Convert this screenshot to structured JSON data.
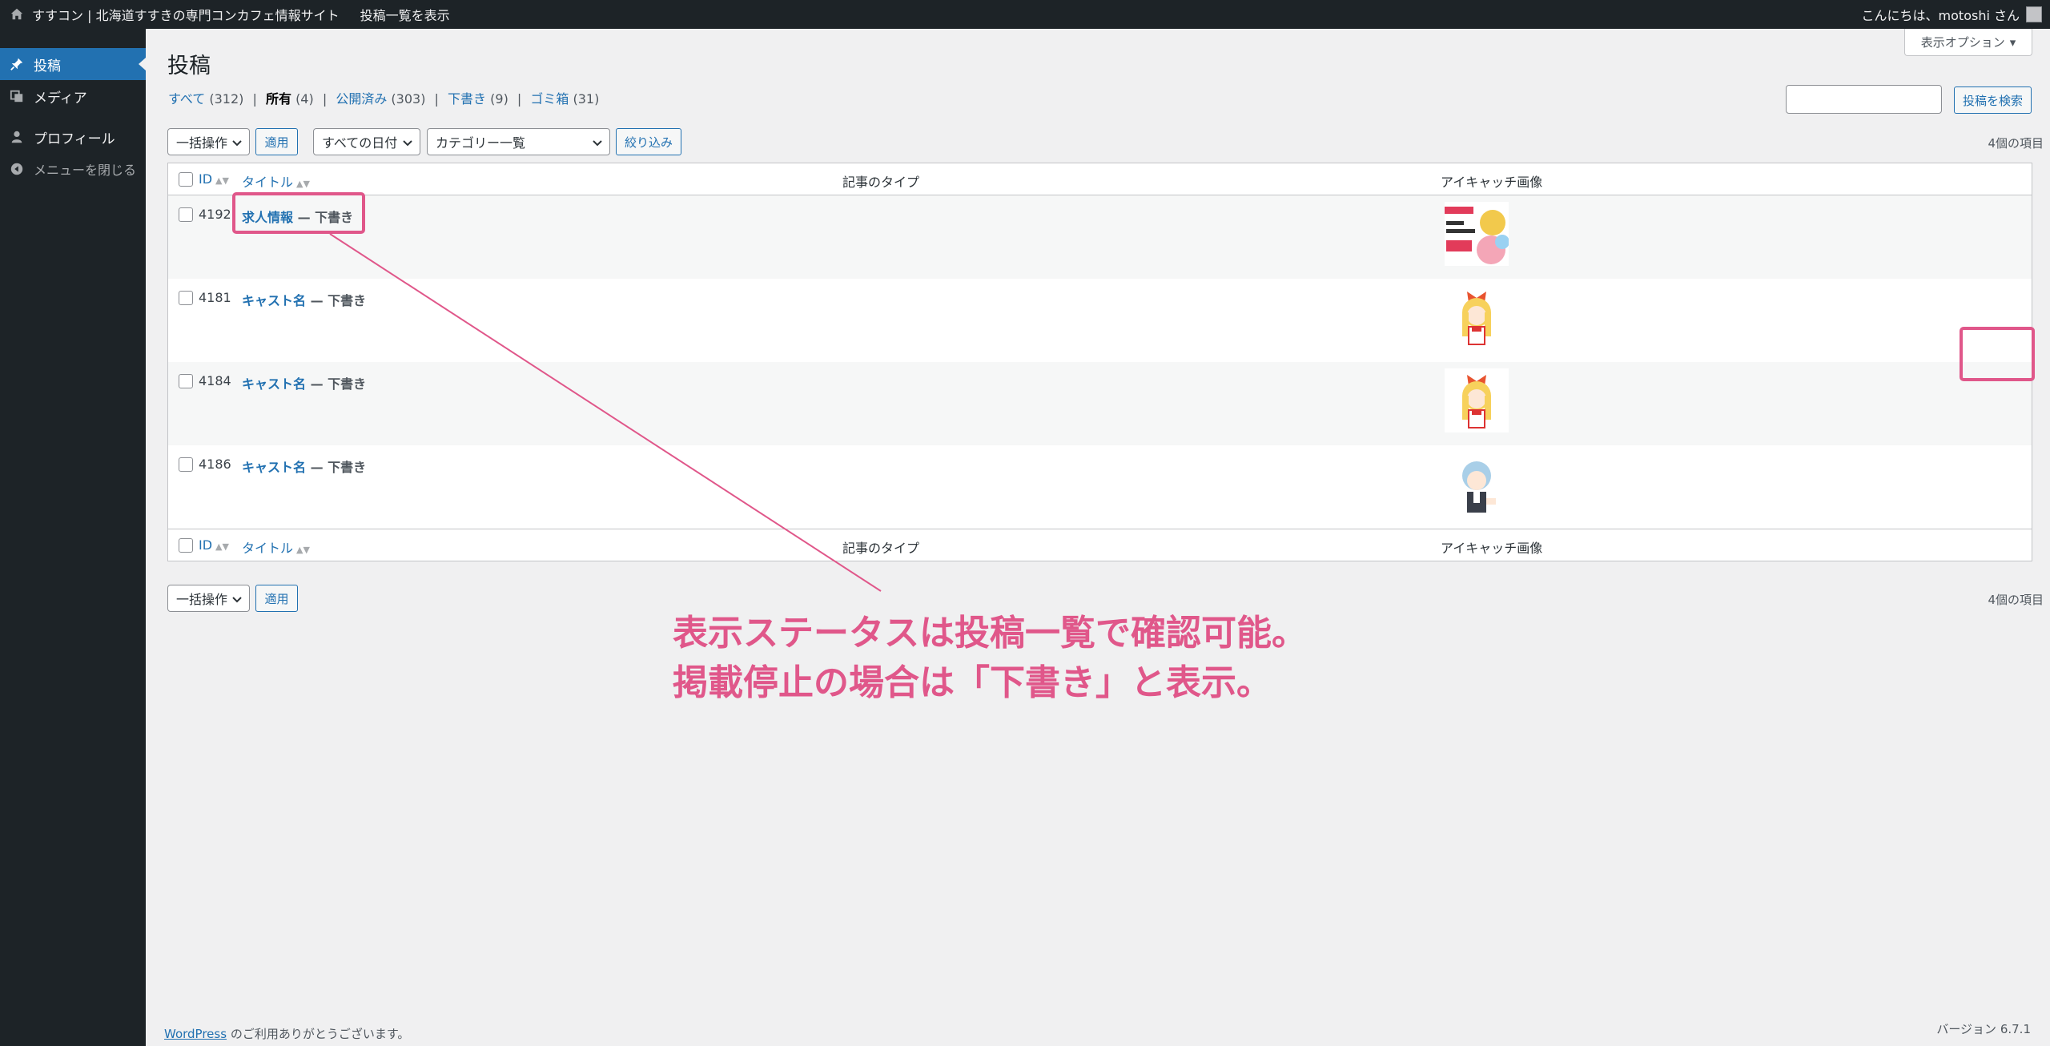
{
  "adminbar": {
    "site_title": "すすコン | 北海道すすきの専門コンカフェ情報サイト",
    "view_link": "投稿一覧を表示",
    "greeting": "こんにちは、motoshi さん"
  },
  "sidebar": {
    "items": [
      {
        "label": "投稿",
        "icon": "pushpin-icon",
        "active": true
      },
      {
        "label": "メディア",
        "icon": "media-icon"
      },
      {
        "label": "プロフィール",
        "icon": "user-icon"
      },
      {
        "label": "メニューを閉じる",
        "icon": "collapse-icon"
      }
    ]
  },
  "page": {
    "title": "投稿",
    "screen_options": "表示オプション"
  },
  "filters": {
    "all": {
      "label": "すべて",
      "count": "(312)"
    },
    "mine": {
      "label": "所有",
      "count": "(4)"
    },
    "published": {
      "label": "公開済み",
      "count": "(303)"
    },
    "draft": {
      "label": "下書き",
      "count": "(9)"
    },
    "trash": {
      "label": "ゴミ箱",
      "count": "(31)"
    }
  },
  "search": {
    "button": "投稿を検索"
  },
  "tablenav": {
    "bulk_action": "一括操作",
    "apply": "適用",
    "date_filter": "すべての日付",
    "category_filter": "カテゴリー一覧",
    "filter_button": "絞り込み",
    "items_count": "4個の項目"
  },
  "table": {
    "columns": [
      "ID",
      "タイトル",
      "記事のタイプ",
      "アイキャッチ画像"
    ],
    "rows": [
      {
        "id": "4192",
        "title": "求人情報",
        "state": " — 下書き",
        "thumb": "banner"
      },
      {
        "id": "4181",
        "title": "キャスト名",
        "state": " — 下書き",
        "thumb": "blonde"
      },
      {
        "id": "4184",
        "title": "キャスト名",
        "state": " — 下書き",
        "thumb": "blonde"
      },
      {
        "id": "4186",
        "title": "キャスト名",
        "state": " — 下書き",
        "thumb": "blue"
      }
    ]
  },
  "footer": {
    "wp_link": "WordPress",
    "thanks": " のご利用ありがとうございます。",
    "version": "バージョン 6.7.1"
  },
  "annotation": {
    "line1": "表示ステータスは投稿一覧で確認可能。",
    "line2": "掲載停止の場合は「下書き」と表示。",
    "color": "#e0578a"
  },
  "colors": {
    "accent": "#2271b1",
    "admin_dark": "#1d2327"
  }
}
